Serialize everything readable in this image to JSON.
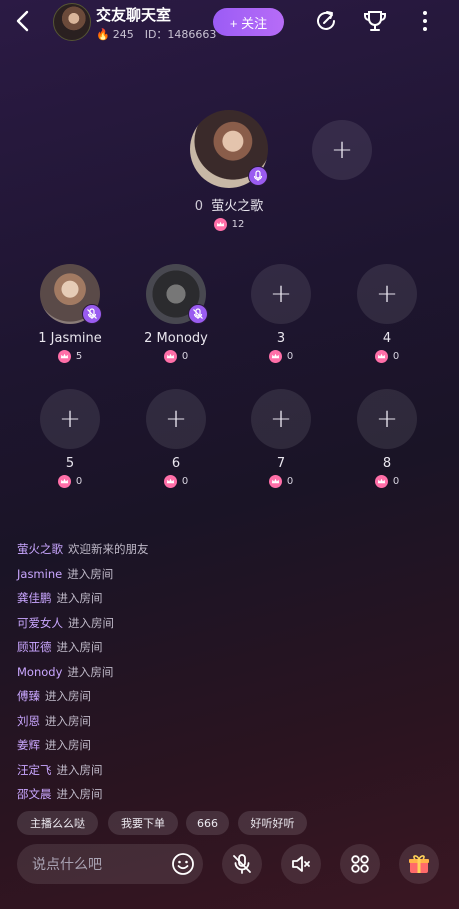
{
  "header": {
    "room_title": "交友聊天室",
    "popularity": "245",
    "room_id": "ID：1486663",
    "follow_label": "+ 关注"
  },
  "host_seat": {
    "index": "0",
    "name": "萤火之歌",
    "score": "12"
  },
  "seats": [
    {
      "index": "1",
      "name": "Jasmine",
      "score": "5"
    },
    {
      "index": "2",
      "name": "Monody",
      "score": "0"
    },
    {
      "index": "3",
      "name": "",
      "score": "0"
    },
    {
      "index": "4",
      "name": "",
      "score": "0"
    },
    {
      "index": "5",
      "name": "",
      "score": "0"
    },
    {
      "index": "6",
      "name": "",
      "score": "0"
    },
    {
      "index": "7",
      "name": "",
      "score": "0"
    },
    {
      "index": "8",
      "name": "",
      "score": "0"
    }
  ],
  "chat": [
    {
      "user": "萤火之歌",
      "msg": "欢迎新来的朋友"
    },
    {
      "user": "Jasmine",
      "msg": "进入房间"
    },
    {
      "user": "龚佳鹏",
      "msg": "进入房间"
    },
    {
      "user": "可爱女人",
      "msg": "进入房间"
    },
    {
      "user": "顾亚德",
      "msg": "进入房间"
    },
    {
      "user": "Monody",
      "msg": "进入房间"
    },
    {
      "user": "傅臻",
      "msg": "进入房间"
    },
    {
      "user": "刘恩",
      "msg": "进入房间"
    },
    {
      "user": "姜辉",
      "msg": "进入房间"
    },
    {
      "user": "汪定飞",
      "msg": "进入房间"
    },
    {
      "user": "邵文晨",
      "msg": "进入房间"
    }
  ],
  "quick_replies": [
    "主播么么哒",
    "我要下单",
    "666",
    "好听好听"
  ],
  "input": {
    "placeholder": "说点什么吧"
  },
  "colors": {
    "accent": "#9b5cf5",
    "username": "#c9a6ff",
    "score_badge": "#ff6fa8"
  }
}
